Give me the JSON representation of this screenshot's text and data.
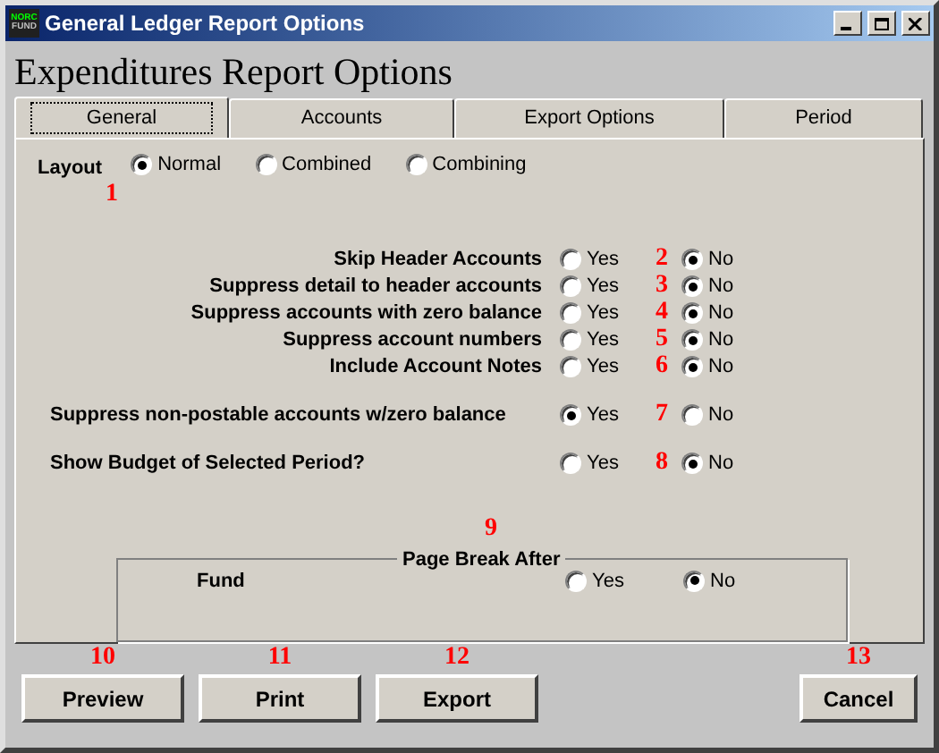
{
  "window": {
    "title": "General Ledger Report Options",
    "logo_top": "NORC",
    "logo_bottom": "FUND"
  },
  "heading": "Expenditures Report Options",
  "tabs": [
    {
      "label": "General",
      "selected": true
    },
    {
      "label": "Accounts",
      "selected": false
    },
    {
      "label": "Export Options",
      "selected": false
    },
    {
      "label": "Period",
      "selected": false
    }
  ],
  "layout": {
    "label": "Layout",
    "marker": "1",
    "options": [
      {
        "label": "Normal",
        "selected": true
      },
      {
        "label": "Combined",
        "selected": false
      },
      {
        "label": "Combining",
        "selected": false
      }
    ]
  },
  "option_groups": [
    [
      {
        "label": "Skip Header Accounts",
        "marker": "2",
        "choices": [
          {
            "label": "Yes",
            "selected": false
          },
          {
            "label": "No",
            "selected": true
          }
        ]
      },
      {
        "label": "Suppress detail to header accounts",
        "marker": "3",
        "choices": [
          {
            "label": "Yes",
            "selected": false
          },
          {
            "label": "No",
            "selected": true
          }
        ]
      },
      {
        "label": "Suppress accounts with zero balance",
        "marker": "4",
        "choices": [
          {
            "label": "Yes",
            "selected": false
          },
          {
            "label": "No",
            "selected": true
          }
        ]
      },
      {
        "label": "Suppress account numbers",
        "marker": "5",
        "choices": [
          {
            "label": "Yes",
            "selected": false
          },
          {
            "label": "No",
            "selected": true
          }
        ]
      },
      {
        "label": "Include Account Notes",
        "marker": "6",
        "choices": [
          {
            "label": "Yes",
            "selected": false
          },
          {
            "label": "No",
            "selected": true
          }
        ]
      }
    ],
    [
      {
        "label": "Suppress non-postable accounts w/zero balance",
        "marker": "7",
        "choices": [
          {
            "label": "Yes",
            "selected": true
          },
          {
            "label": "No",
            "selected": false
          }
        ]
      }
    ],
    [
      {
        "label": "Show Budget of Selected Period?",
        "marker": "8",
        "choices": [
          {
            "label": "Yes",
            "selected": false
          },
          {
            "label": "No",
            "selected": true
          }
        ]
      }
    ]
  ],
  "page_break": {
    "title": "Page Break After",
    "marker": "9",
    "label": "Fund",
    "choices": [
      {
        "label": "Yes",
        "selected": false
      },
      {
        "label": "No",
        "selected": true
      }
    ]
  },
  "buttons": [
    {
      "label": "Preview",
      "marker": "10"
    },
    {
      "label": "Print",
      "marker": "11"
    },
    {
      "label": "Export",
      "marker": "12"
    },
    {
      "label": "Cancel",
      "marker": "13"
    }
  ]
}
